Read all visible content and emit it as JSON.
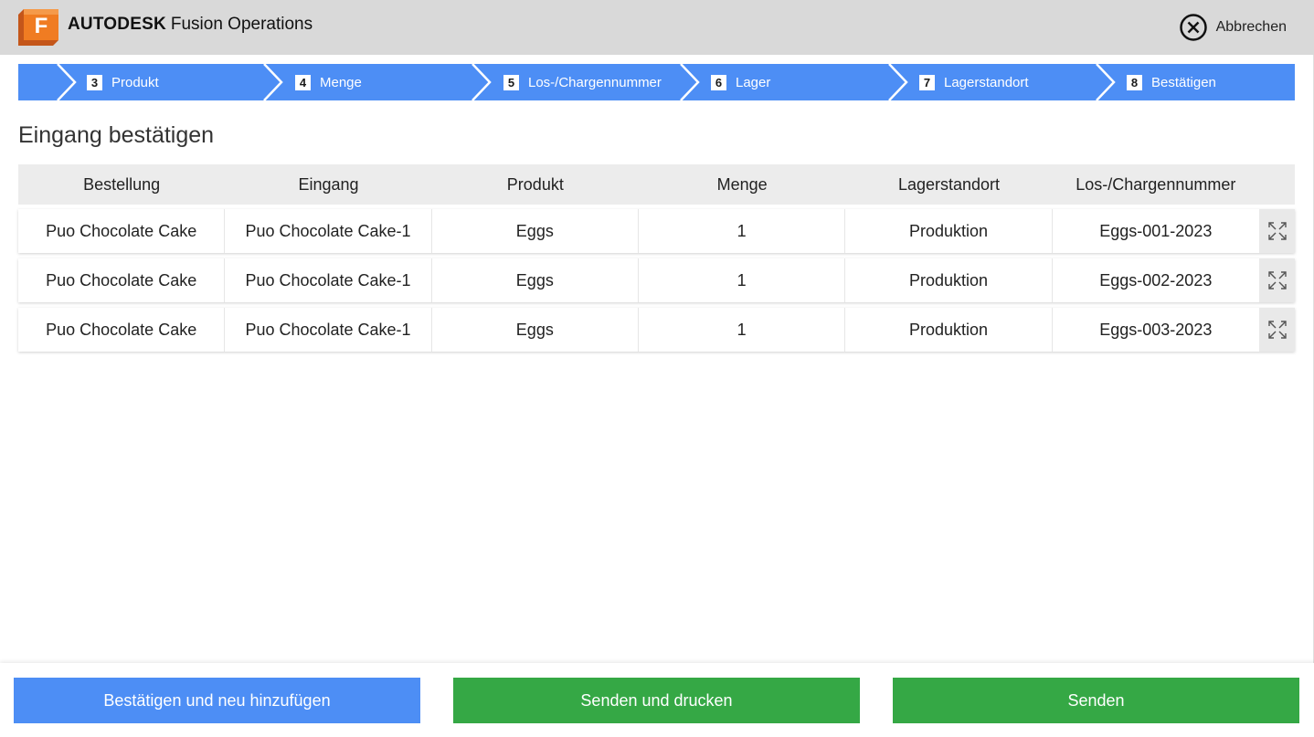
{
  "app": {
    "company": "AUTODESK",
    "product": "Fusion Operations",
    "logo_letter": "F",
    "logo_icon": "fusion-logo-icon"
  },
  "header": {
    "cancel_label": "Abbrechen",
    "cancel_icon": "close-circle-icon"
  },
  "steps": [
    {
      "number": "3",
      "label": "Produkt"
    },
    {
      "number": "4",
      "label": "Menge"
    },
    {
      "number": "5",
      "label": "Los-/Chargennummer"
    },
    {
      "number": "6",
      "label": "Lager"
    },
    {
      "number": "7",
      "label": "Lagerstandort"
    },
    {
      "number": "8",
      "label": "Bestätigen"
    }
  ],
  "page_title": "Eingang bestätigen",
  "table": {
    "columns": [
      "Bestellung",
      "Eingang",
      "Produkt",
      "Menge",
      "Lagerstandort",
      "Los-/Chargennummer"
    ],
    "rows": [
      [
        "Puo Chocolate Cake",
        "Puo Chocolate Cake-1",
        "Eggs",
        "1",
        "Produktion",
        "Eggs-001-2023"
      ],
      [
        "Puo Chocolate Cake",
        "Puo Chocolate Cake-1",
        "Eggs",
        "1",
        "Produktion",
        "Eggs-002-2023"
      ],
      [
        "Puo Chocolate Cake",
        "Puo Chocolate Cake-1",
        "Eggs",
        "1",
        "Produktion",
        "Eggs-003-2023"
      ]
    ],
    "row_action_icon": "expand-icon"
  },
  "footer": {
    "confirm_add_label": "Bestätigen und neu hinzufügen",
    "send_print_label": "Senden und drucken",
    "send_label": "Senden"
  },
  "colors": {
    "header_bg": "#d9d9d9",
    "step_blue": "#4d8ef5",
    "button_blue": "#4d8ef5",
    "button_green": "#35a845",
    "logo_orange": "#f07c22"
  }
}
